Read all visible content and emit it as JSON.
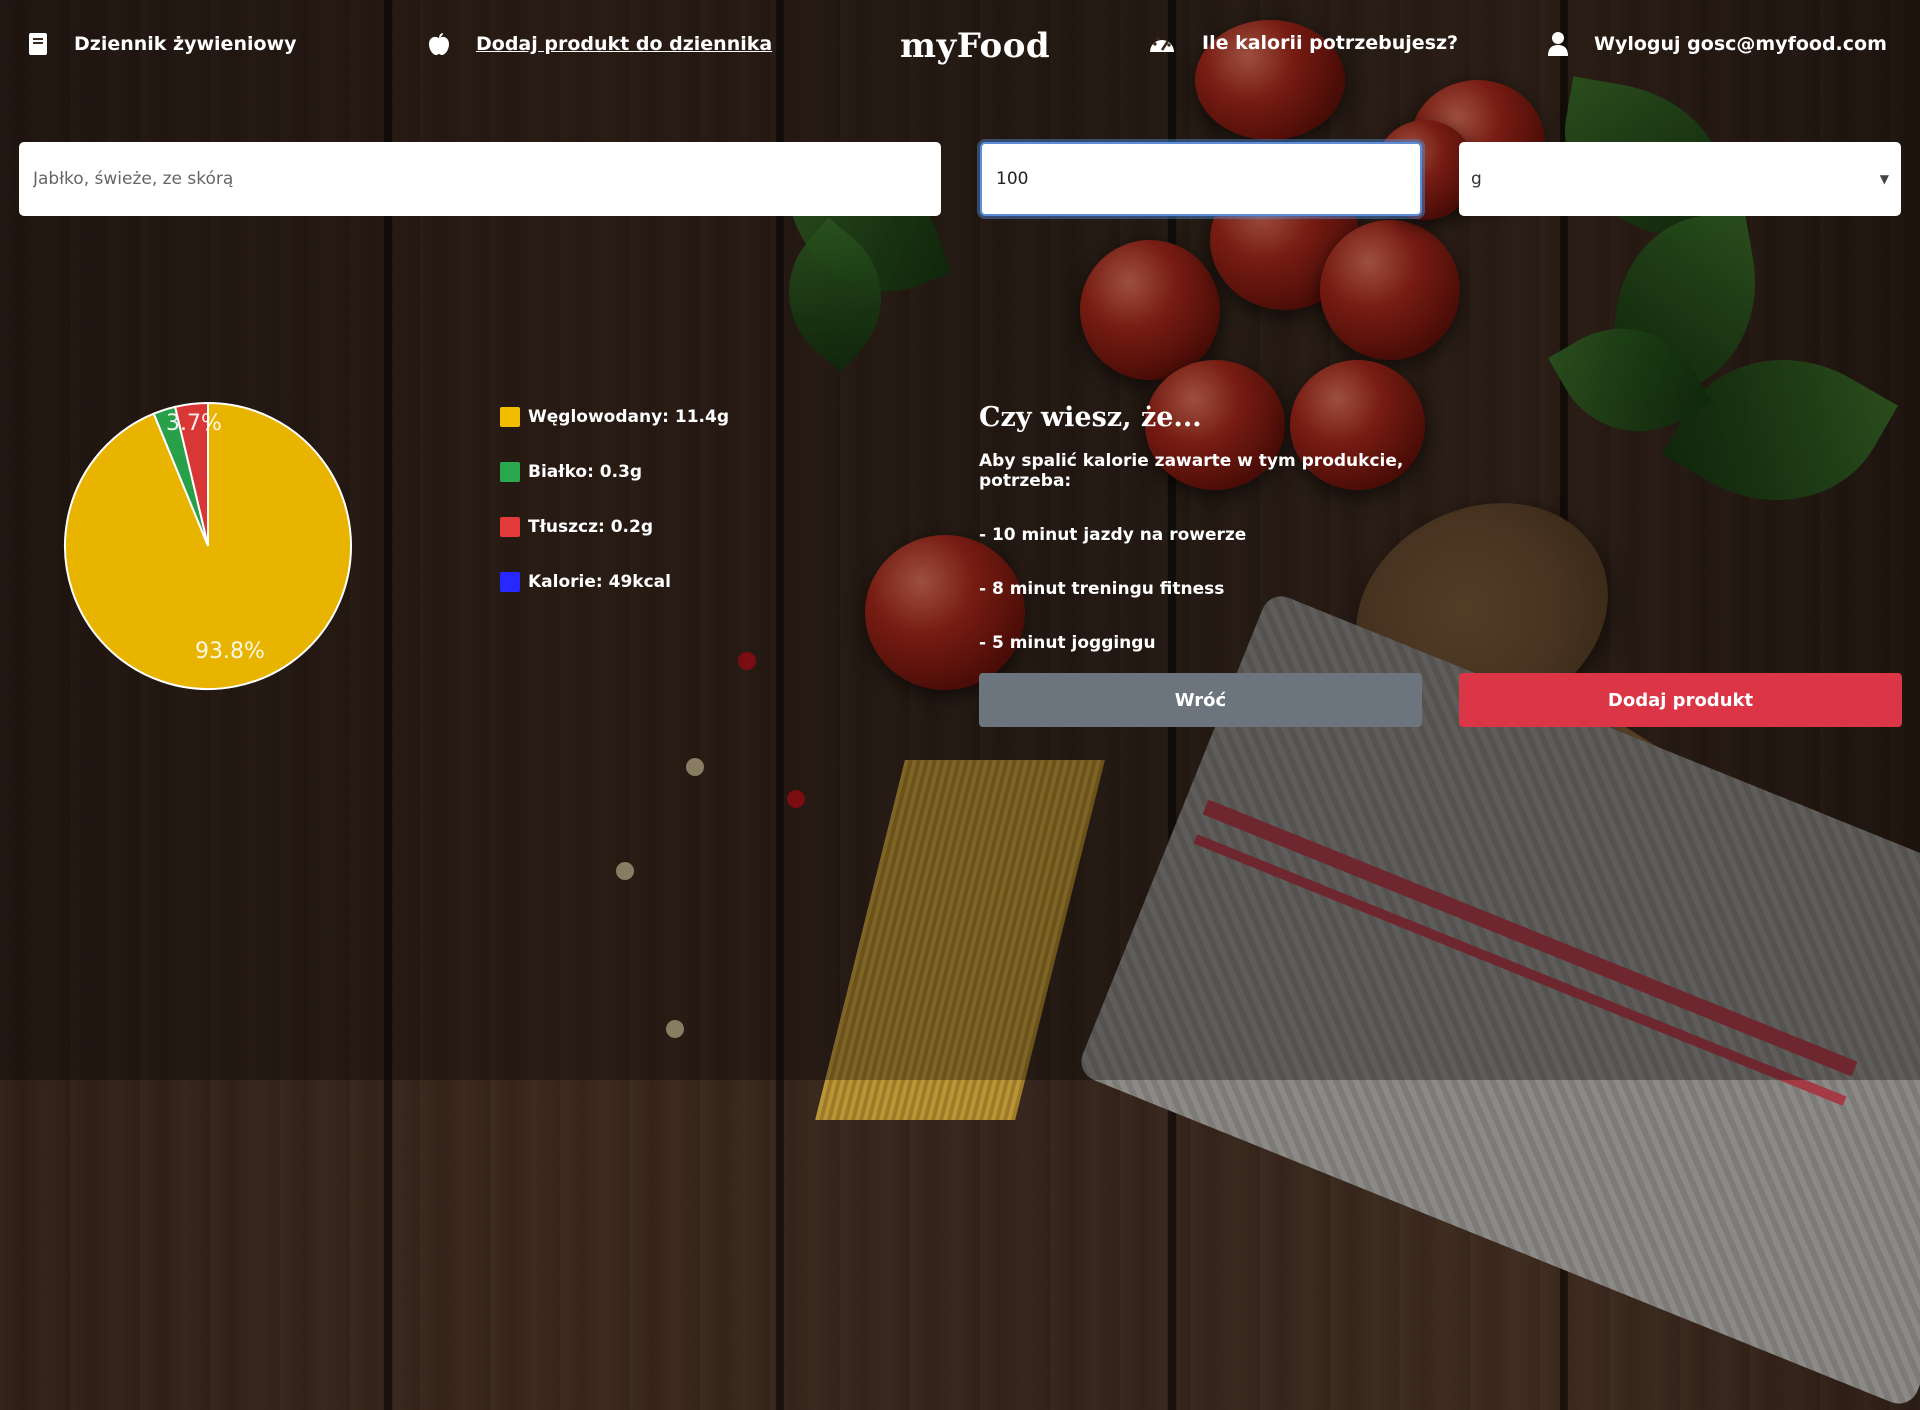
{
  "nav": {
    "diary": "Dziennik żywieniowy",
    "add_product": "Dodaj produkt do dziennika",
    "brand": "myFood",
    "calories": "Ile kalorii potrzebujesz?",
    "logout": "Wyloguj gosc@myfood.com"
  },
  "form": {
    "product_placeholder": "Jabłko, świeże, ze skórą",
    "amount_value": "100",
    "unit_selected": "g"
  },
  "chart_data": {
    "type": "pie",
    "slices": [
      {
        "label": "Węglowodany",
        "value": 93.8,
        "color": "#e8b400"
      },
      {
        "label": "Białko",
        "value": 2.5,
        "color": "#28a04a"
      },
      {
        "label": "Tłuszcz",
        "value": 3.7,
        "color": "#d93636"
      }
    ],
    "data_labels": [
      "93.8%",
      "3.7%"
    ]
  },
  "legend": [
    {
      "label": "Węglowodany: 11.4g",
      "color": "#f2bd00"
    },
    {
      "label": "Białko: 0.3g",
      "color": "#2aa84e"
    },
    {
      "label": "Tłuszcz: 0.2g",
      "color": "#e23a3a"
    },
    {
      "label": "Kalorie: 49kcal",
      "color": "#2727ff"
    }
  ],
  "info": {
    "title": "Czy wiesz, że...",
    "intro": "Aby spalić kalorie zawarte w tym produkcie, potrzeba:",
    "lines": [
      "- 10 minut jazdy na rowerze",
      "- 8 minut treningu fitness",
      "- 5 minut joggingu"
    ]
  },
  "buttons": {
    "back": "Wróć",
    "add": "Dodaj produkt"
  }
}
